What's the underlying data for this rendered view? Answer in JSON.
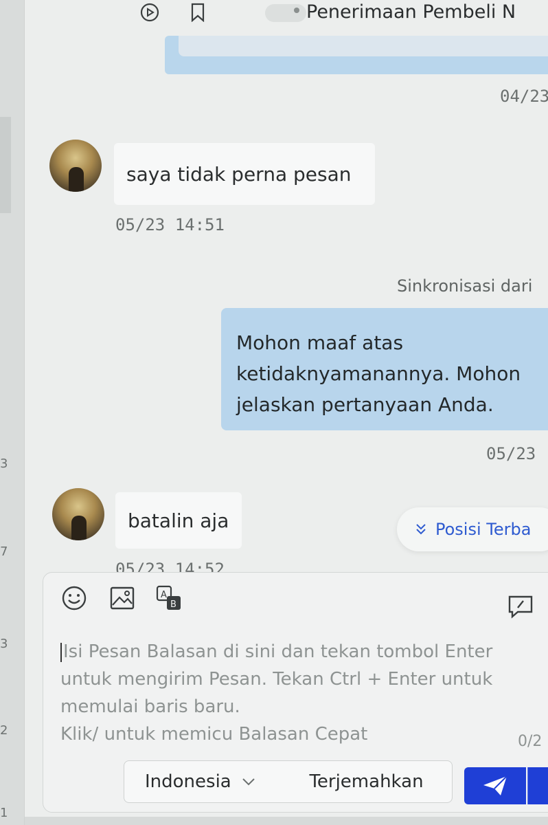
{
  "header": {
    "title": "Penerimaan Pembeli N"
  },
  "icons": {
    "play": "play-circle-icon",
    "bookmark": "bookmark-icon",
    "emoji": "smiley-icon",
    "image": "image-icon",
    "translate": "translate-icon",
    "feedback": "feedback-icon",
    "send": "send-icon"
  },
  "sidebar_numbers": [
    "3",
    "7",
    "3",
    "2",
    "1"
  ],
  "messages": {
    "top_timestamp": "04/23",
    "msg1": {
      "text": "saya tidak perna pesan",
      "time": "05/23 14:51"
    },
    "sync_note": "Sinkronisasi dari",
    "msg2": {
      "lines": [
        "Mohon maaf atas",
        "ketidaknyamanannya. Mohon",
        "jelaskan pertanyaan Anda."
      ],
      "time": "05/23"
    },
    "msg3": {
      "text": "batalin aja",
      "time": "05/23 14:52"
    }
  },
  "jump_latest": {
    "label": "Posisi Terba"
  },
  "compose": {
    "placeholder_lines": [
      "Isi Pesan Balasan di sini dan tekan tombol Enter",
      "untuk mengirim Pesan. Tekan Ctrl + Enter untuk",
      "memulai baris baru.",
      "Klik/ untuk memicu Balasan Cepat"
    ],
    "counter": "0/2",
    "language_value": "Indonesia",
    "translate_label": "Terjemahkan"
  },
  "colors": {
    "accent": "#1f3fd6",
    "sent_bubble": "#b8d5ec",
    "link": "#2e5bd0"
  }
}
